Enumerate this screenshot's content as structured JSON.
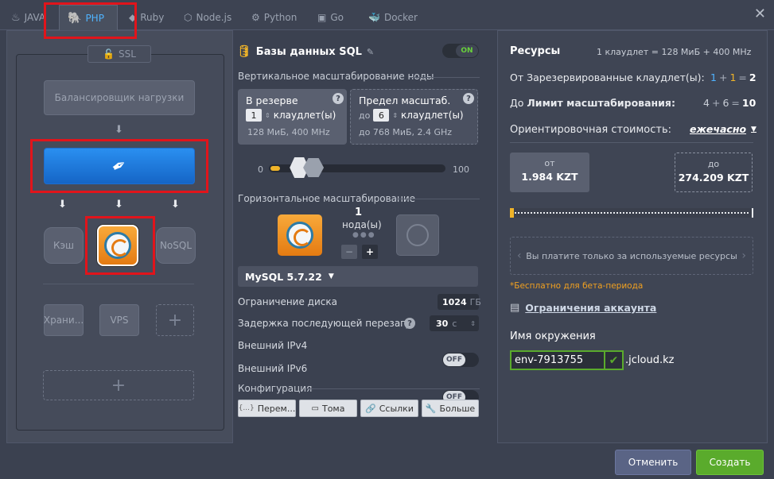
{
  "tabs": [
    {
      "label": "JAVA",
      "icon": "java-icon"
    },
    {
      "label": "PHP",
      "icon": "php-icon"
    },
    {
      "label": "Ruby",
      "icon": "ruby-icon"
    },
    {
      "label": "Node.js",
      "icon": "nodejs-icon"
    },
    {
      "label": "Python",
      "icon": "python-icon"
    },
    {
      "label": "Go",
      "icon": "go-icon"
    },
    {
      "label": "Docker",
      "icon": "docker-icon"
    }
  ],
  "close_symbol": "✕",
  "topology": {
    "ssl_label": "SSL",
    "balancer_label": "Балансировщик нагрузки",
    "cache_label": "Кэш",
    "nosql_label": "NoSQL",
    "storage_label": "Храни...",
    "vps_label": "VPS",
    "plus": "+"
  },
  "db": {
    "title": "Базы данных SQL",
    "toggle": "ON",
    "vertical_title": "Вертикальное масштабирование ноды",
    "reserved_title": "В резерве",
    "reserved_value": "1",
    "reserved_unit": "клаудлет(ы)",
    "reserved_info": "128 МиБ, 400 MHz",
    "limit_title": "Предел масштаб.",
    "limit_prefix": "до",
    "limit_value": "6",
    "limit_unit": "клаудлет(ы)",
    "limit_info_prefix": "до",
    "limit_info": "768 МиБ, 2.4 GHz",
    "slider_min": "0",
    "slider_max": "100",
    "slider_reserved": 1,
    "slider_limit": 6,
    "horizontal_title": "Горизонтальное масштабирование",
    "node_count": "1",
    "node_label": "нода(ы)",
    "minus": "−",
    "plus": "+",
    "version": "MySQL 5.7.22",
    "disk_label": "Ограничение диска",
    "disk_value": "1024",
    "disk_unit": "ГБ",
    "restart_label": "Задержка последующей перезагр.",
    "restart_value": "30",
    "restart_unit": "с",
    "ipv4_label": "Внешний IPv4",
    "ipv4_toggle": "OFF",
    "ipv6_label": "Внешний IPv6",
    "ipv6_toggle": "OFF",
    "config_label": "Конфигурация",
    "config_buttons": [
      "Перем...",
      "Тома",
      "Ссылки",
      "Больше"
    ],
    "config_prefixes": [
      "{...}",
      "",
      "",
      ""
    ]
  },
  "resources": {
    "title": "Ресурсы",
    "cloudlet_def": "1 клаудлет = 128 МиБ + 400 МHz",
    "reserved_prefix": "От",
    "reserved_label": "Зарезервированные клаудлет(ы):",
    "reserved_a": "1",
    "reserved_b": "1",
    "reserved_total": "2",
    "limit_prefix": "До",
    "limit_label": "Лимит масштабирования:",
    "limit_a": "4",
    "limit_b": "6",
    "limit_total": "10",
    "plus": "+",
    "equals": "=",
    "cost_label": "Ориентировочная стоимость:",
    "cost_period": "ежечасно",
    "from_label": "от",
    "from_value": "1.984 KZT",
    "to_label": "до",
    "to_value": "274.209 KZT",
    "payg_text": "Вы платите только за используемые ресурсы",
    "beta_note": "*Бесплатно для бета-периода",
    "account_link": "Ограничения аккаунта",
    "env_label": "Имя окружения",
    "env_value": "env-7913755",
    "env_domain": ".jcloud.kz"
  },
  "footer": {
    "cancel": "Отменить",
    "create": "Создать"
  },
  "colors": {
    "accent_blue": "#2a8ff0",
    "orange": "#f08b1f",
    "green": "#5aab2c",
    "highlight_red": "#e1141b"
  }
}
